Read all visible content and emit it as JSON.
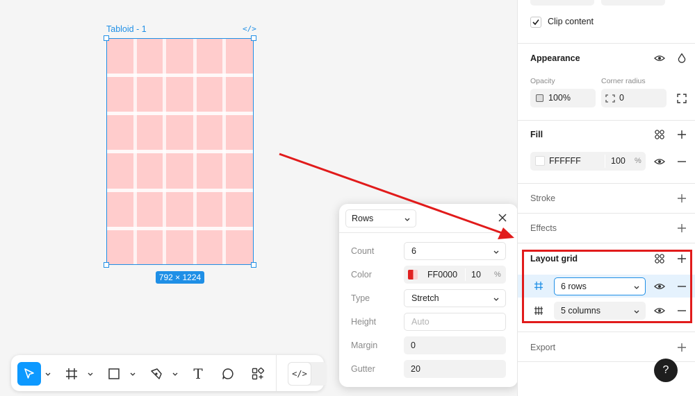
{
  "canvas": {
    "frame_name": "Tabloid - 1",
    "frame_code_glyph": "</>",
    "frame_dimensions": "792 × 1224",
    "frame_fill_color": "#ffcccc",
    "selection_color": "#1f8fe6"
  },
  "toolbar": {
    "tools": [
      "move-tool",
      "frame-tool",
      "rectangle-tool",
      "pen-tool",
      "text-tool",
      "comment-tool",
      "actions-tool"
    ],
    "active_tool": "move-tool",
    "code_glyph": "</>",
    "text_tool_glyph": "T"
  },
  "grid_popup": {
    "type_value": "Rows",
    "count_label": "Count",
    "count_value": "6",
    "color_label": "Color",
    "color_hex": "FF0000",
    "color_opacity": "10",
    "color_percent": "%",
    "type_label": "Type",
    "type_field": "Stretch",
    "height_label": "Height",
    "height_placeholder": "Auto",
    "margin_label": "Margin",
    "margin_value": "0",
    "gutter_label": "Gutter",
    "gutter_value": "20"
  },
  "panel": {
    "clip_content_label": "Clip content",
    "clip_content_checked": true,
    "appearance": {
      "title": "Appearance",
      "opacity_label": "Opacity",
      "opacity_value": "100%",
      "corner_label": "Corner radius",
      "corner_value": "0"
    },
    "fill": {
      "title": "Fill",
      "hex": "FFFFFF",
      "opacity": "100",
      "percent": "%"
    },
    "stroke": {
      "title": "Stroke"
    },
    "effects": {
      "title": "Effects"
    },
    "layout_grid": {
      "title": "Layout grid",
      "items": [
        {
          "label": "6 rows",
          "icon": "rows-grid-icon"
        },
        {
          "label": "5 columns",
          "icon": "columns-grid-icon"
        }
      ]
    },
    "export": {
      "title": "Export"
    },
    "help_label": "?"
  },
  "colors": {
    "accent": "#0d99ff",
    "annotation_red": "#e11b1b",
    "grid_red": "#FF0000"
  }
}
